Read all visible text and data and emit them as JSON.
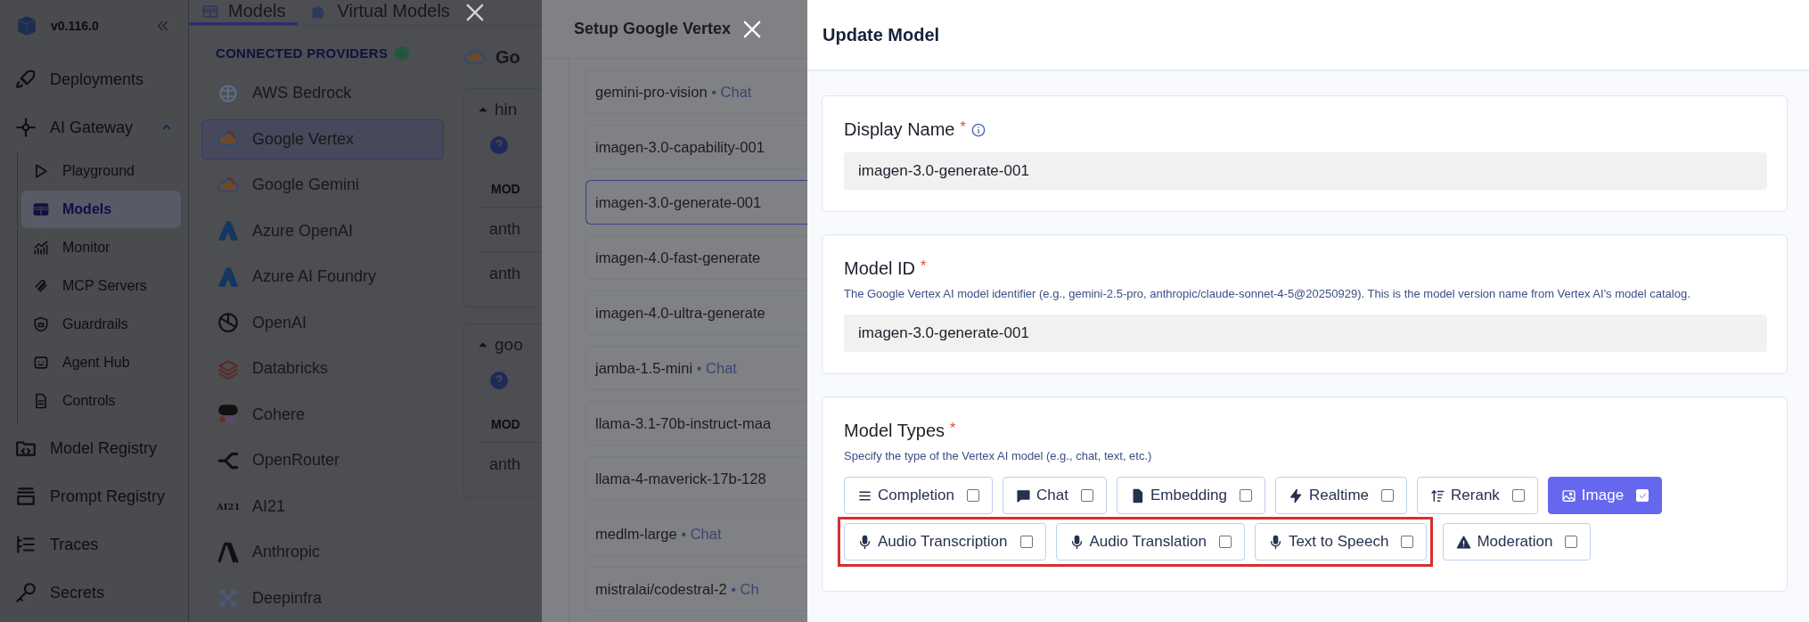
{
  "sidebar": {
    "version": "v0.116.0",
    "items": [
      {
        "label": "Deployments"
      },
      {
        "label": "AI Gateway",
        "expanded": true,
        "children": [
          {
            "label": "Playground",
            "selected": false
          },
          {
            "label": "Models",
            "selected": true
          },
          {
            "label": "Monitor",
            "selected": false
          },
          {
            "label": "MCP Servers",
            "selected": false
          },
          {
            "label": "Guardrails",
            "selected": false
          },
          {
            "label": "Agent Hub",
            "selected": false
          },
          {
            "label": "Controls",
            "selected": false
          }
        ]
      },
      {
        "label": "Model Registry"
      },
      {
        "label": "Prompt Registry"
      },
      {
        "label": "Traces"
      },
      {
        "label": "Secrets"
      }
    ]
  },
  "tabs": [
    {
      "label": "Models",
      "selected": true
    },
    {
      "label": "Virtual Models",
      "selected": false
    }
  ],
  "providers": {
    "heading": "CONNECTED PROVIDERS",
    "items": [
      {
        "name": "AWS Bedrock",
        "selected": false
      },
      {
        "name": "Google Vertex",
        "selected": true
      },
      {
        "name": "Google Gemini",
        "selected": false
      },
      {
        "name": "Azure OpenAI",
        "selected": false
      },
      {
        "name": "Azure AI Foundry",
        "selected": false
      },
      {
        "name": "OpenAI",
        "selected": false
      },
      {
        "name": "Databricks",
        "selected": false
      },
      {
        "name": "Cohere",
        "selected": false
      },
      {
        "name": "OpenRouter",
        "selected": false
      },
      {
        "name": "AI21",
        "selected": false,
        "logo_text": "AI21"
      },
      {
        "name": "Anthropic",
        "selected": false
      },
      {
        "name": "Deepinfra",
        "selected": false
      }
    ]
  },
  "provider_detail": {
    "title": "Go",
    "groups": [
      {
        "name": "hin",
        "column": "MOD",
        "rows": [
          "anth",
          "anth"
        ]
      },
      {
        "name": "goo",
        "column": "MOD",
        "rows": [
          "anth"
        ]
      }
    ]
  },
  "setup_panel": {
    "title": "Setup Google Vertex",
    "models": [
      {
        "name": "gemini-pro-vision",
        "type": "• Chat",
        "selected": false
      },
      {
        "name": "imagen-3.0-capability-001",
        "selected": false
      },
      {
        "name": "imagen-3.0-generate-001",
        "selected": true
      },
      {
        "name": "imagen-4.0-fast-generate",
        "selected": false
      },
      {
        "name": "imagen-4.0-ultra-generate",
        "selected": false
      },
      {
        "name": "jamba-1.5-mini",
        "type": "• Chat",
        "selected": false
      },
      {
        "name": "llama-3.1-70b-instruct-maa",
        "selected": false
      },
      {
        "name": "llama-4-maverick-17b-128",
        "selected": false
      },
      {
        "name": "medlm-large",
        "type": "• Chat",
        "selected": false
      },
      {
        "name": "mistralai/codestral-2",
        "type": "• Ch",
        "selected": false
      }
    ]
  },
  "update_model": {
    "title": "Update Model",
    "display_name": {
      "label": "Display Name",
      "required_mark": "*",
      "value": "imagen-3.0-generate-001"
    },
    "model_id": {
      "label": "Model ID",
      "required_mark": "*",
      "help": "The Google Vertex AI model identifier (e.g., gemini-2.5-pro, anthropic/claude-sonnet-4-5@20250929). This is the model version name from Vertex AI's model catalog.",
      "value": "imagen-3.0-generate-001"
    },
    "model_types": {
      "label": "Model Types",
      "required_mark": "*",
      "help": "Specify the type of the Vertex AI model (e.g., chat, text, etc.)",
      "rows": [
        {
          "options": [
            {
              "label": "Completion",
              "checked": false,
              "highlighted": false
            },
            {
              "label": "Chat",
              "checked": false,
              "highlighted": false
            },
            {
              "label": "Embedding",
              "checked": false,
              "highlighted": false
            },
            {
              "label": "Realtime",
              "checked": false,
              "highlighted": false
            },
            {
              "label": "Rerank",
              "checked": false,
              "highlighted": false
            },
            {
              "label": "Image",
              "checked": true,
              "highlighted": false
            }
          ]
        },
        {
          "options": [
            {
              "label": "Audio Transcription",
              "checked": false,
              "highlighted": true
            },
            {
              "label": "Audio Translation",
              "checked": false,
              "highlighted": true
            },
            {
              "label": "Text to Speech",
              "checked": false,
              "highlighted": true
            },
            {
              "label": "Moderation",
              "checked": false,
              "highlighted": false
            }
          ]
        }
      ]
    }
  }
}
